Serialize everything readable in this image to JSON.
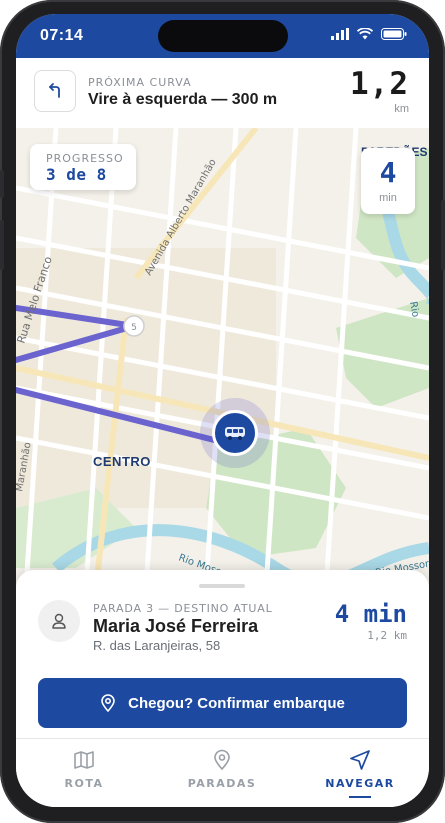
{
  "status_bar": {
    "time": "07:14"
  },
  "turn": {
    "label": "PRÓXIMA CURVA",
    "instruction": "Vire à esquerda — 300 m",
    "distance_value": "1,2",
    "distance_unit": "km",
    "icon": "turn-left-arrow-icon"
  },
  "map": {
    "progress": {
      "label": "PROGRESSO",
      "value": "3 de 8"
    },
    "eta": {
      "value": "4",
      "unit": "min"
    },
    "labels": {
      "top_right": "PAREDÕES",
      "centro": "CENTRO",
      "rua_melo_franco": "Rua Melo Franco",
      "avenida": "Avenida Alberto Maranhão",
      "maranhao": "Maranhão",
      "rio_mossoro": "Rio Mossoró",
      "rio": "Rio",
      "waypoint": "5"
    },
    "colors": {
      "route": "#6b64cf",
      "park": "#cfe6c4",
      "water": "#a9d8e6",
      "base": "#f4f1ea"
    }
  },
  "stop": {
    "label": "PARADA 3 — DESTINO ATUAL",
    "name": "Maria José Ferreira",
    "address": "R. das Laranjeiras, 58",
    "eta": "4 min",
    "distance": "1,2 km",
    "confirm_label": "Chegou? Confirmar embarque"
  },
  "tabs": [
    {
      "label": "ROTA",
      "icon": "map-icon",
      "active": false
    },
    {
      "label": "PARADAS",
      "icon": "location-pin-icon",
      "active": false
    },
    {
      "label": "NAVEGAR",
      "icon": "navigation-arrow-icon",
      "active": true
    }
  ],
  "accent": "#1d4aa0"
}
